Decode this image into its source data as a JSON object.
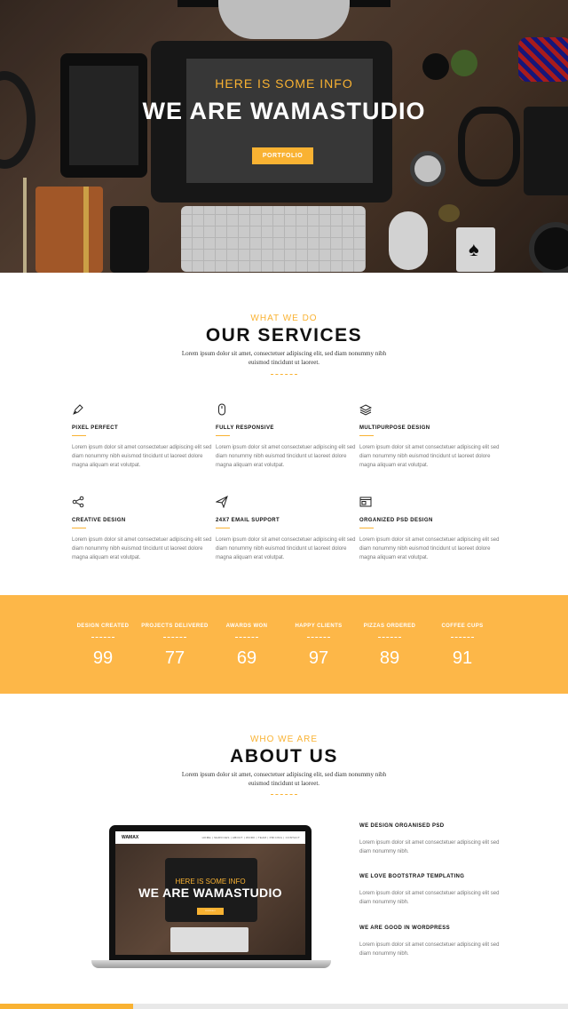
{
  "hero": {
    "subtitle": "HERE IS SOME INFO",
    "title": "WE ARE WAMASTUDIO",
    "button_label": "PORTFOLIO"
  },
  "services_section": {
    "subtitle": "WHAT WE DO",
    "title": "OUR SERVICES",
    "description": "Lorem ipsum dolor sit amet, consectetuer adipiscing elit, sed diam nonummy nibh euismod tincidunt ut laoreet.",
    "items": [
      {
        "icon": "pen-icon",
        "title": "PIXEL PERFECT",
        "text": "Lorem ipsum dolor sit amet consectetuer adipiscing elit sed diam nonummy nibh euismod tincidunt ut laoreet dolore magna aliquam erat volutpat."
      },
      {
        "icon": "mouse-icon",
        "title": "FULLY RESPONSIVE",
        "text": "Lorem ipsum dolor sit amet consectetuer adipiscing elit sed diam nonummy nibh euismod tincidunt ut laoreet dolore magna aliquam erat volutpat."
      },
      {
        "icon": "layers-icon",
        "title": "MULTIPURPOSE DESIGN",
        "text": "Lorem ipsum dolor sit amet consectetuer adipiscing elit sed diam nonummy nibh euismod tincidunt ut laoreet dolore magna aliquam erat volutpat."
      },
      {
        "icon": "share-icon",
        "title": "CREATIVE DESIGN",
        "text": "Lorem ipsum dolor sit amet consectetuer adipiscing elit sed diam nonummy nibh euismod tincidunt ut laoreet dolore magna aliquam erat volutpat."
      },
      {
        "icon": "paper-plane-icon",
        "title": "24X7 EMAIL SUPPORT",
        "text": "Lorem ipsum dolor sit amet consectetuer adipiscing elit sed diam nonummy nibh euismod tincidunt ut laoreet dolore magna aliquam erat volutpat."
      },
      {
        "icon": "browser-window-icon",
        "title": "ORGANIZED PSD DESIGN",
        "text": "Lorem ipsum dolor sit amet consectetuer adipiscing elit sed diam nonummy nibh euismod tincidunt ut laoreet dolore magna aliquam erat volutpat."
      }
    ]
  },
  "stats": [
    {
      "label": "DESIGN CREATED",
      "value": "99"
    },
    {
      "label": "PROJECTS DELIVERED",
      "value": "77"
    },
    {
      "label": "AWARDS WON",
      "value": "69"
    },
    {
      "label": "HAPPY CLIENTS",
      "value": "97"
    },
    {
      "label": "PIZZAS ORDERED",
      "value": "89"
    },
    {
      "label": "COFFEE CUPS",
      "value": "91"
    }
  ],
  "about_section": {
    "subtitle": "WHO WE ARE",
    "title": "ABOUT US",
    "description": "Lorem ipsum dolor sit amet, consectetuer adipiscing elit, sed diam nonummy nibh euismod tincidunt ut laoreet.",
    "features": [
      {
        "title": "WE DESIGN ORGANISED PSD",
        "text": "Lorem ipsum dolor sit amet consectetuer adipiscing elit sed diam nonummy nibh."
      },
      {
        "title": "WE LOVE BOOTSTRAP TEMPLATING",
        "text": "Lorem ipsum dolor sit amet consectetuer adipiscing elit sed diam nonummy nibh."
      },
      {
        "title": "WE ARE GOOD IN WORDPRESS",
        "text": "Lorem ipsum dolor sit amet consectetuer adipiscing elit sed diam nonummy nibh."
      }
    ],
    "laptop_preview": {
      "logo": "WAMAX",
      "menu": "HOME | SERVICES | ABOUT | WORK | TEAM | PRICING | CONTACT",
      "subtitle": "HERE IS SOME INFO",
      "title": "WE ARE WAMASTUDIO",
      "button_label": "PORTFOLIO"
    }
  },
  "scroll_progress": 0.234,
  "colors": {
    "accent": "#f9b232",
    "stats_bg": "#fdb748"
  }
}
